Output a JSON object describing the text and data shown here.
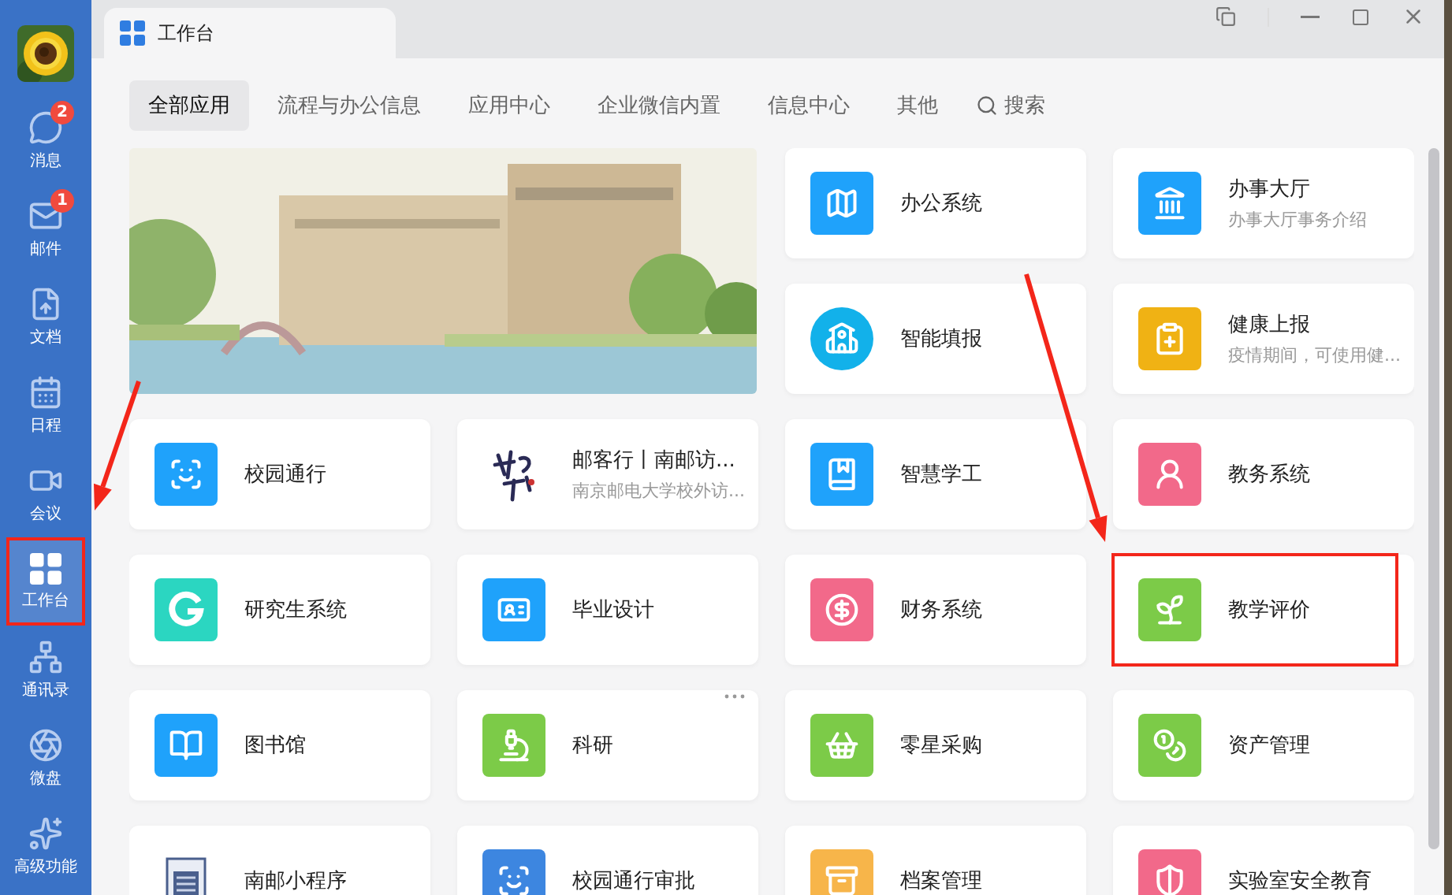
{
  "sidebar": {
    "items": [
      {
        "label": "消息",
        "badge": "2",
        "selected": false,
        "highlighted": false
      },
      {
        "label": "邮件",
        "badge": "1",
        "selected": false,
        "highlighted": false
      },
      {
        "label": "文档",
        "selected": false,
        "highlighted": false
      },
      {
        "label": "日程",
        "selected": false,
        "highlighted": false
      },
      {
        "label": "会议",
        "selected": false,
        "highlighted": false
      },
      {
        "label": "工作台",
        "selected": true,
        "highlighted": true
      },
      {
        "label": "通讯录",
        "selected": false,
        "highlighted": false
      },
      {
        "label": "微盘",
        "selected": false,
        "highlighted": false
      },
      {
        "label": "高级功能",
        "selected": false,
        "highlighted": false
      }
    ]
  },
  "window": {
    "tab_title": "工作台"
  },
  "filter_tabs": [
    {
      "label": "全部应用",
      "selected": true
    },
    {
      "label": "流程与办公信息",
      "selected": false
    },
    {
      "label": "应用中心",
      "selected": false
    },
    {
      "label": "企业微信内置",
      "selected": false
    },
    {
      "label": "信息中心",
      "selected": false
    },
    {
      "label": "其他",
      "selected": false
    }
  ],
  "search": {
    "label": "搜索"
  },
  "apps": [
    {
      "name": "办公系统",
      "kind": "tile",
      "color": "#1fa2fb",
      "highlighted": false
    },
    {
      "name": "办事大厅",
      "subtitle": "办事大厅事务介绍",
      "kind": "tile",
      "color": "#1fa2fb",
      "highlighted": false
    },
    {
      "name": "智能填报",
      "kind": "round",
      "color": "#12b1ea",
      "highlighted": false
    },
    {
      "name": "健康上报",
      "subtitle": "疫情期间，可使用健...",
      "kind": "tile",
      "color": "#f0b214",
      "highlighted": false
    },
    {
      "name": "校园通行",
      "kind": "tile",
      "color": "#1fa2fb",
      "highlighted": false
    },
    {
      "name": "邮客行丨南邮访...",
      "subtitle": "南京邮电大学校外访...",
      "kind": "logo",
      "highlighted": false
    },
    {
      "name": "智慧学工",
      "kind": "tile",
      "color": "#1fa2fb",
      "highlighted": false
    },
    {
      "name": "教务系统",
      "kind": "tile",
      "color": "#f2698a",
      "highlighted": false
    },
    {
      "name": "研究生系统",
      "kind": "tile",
      "color": "#2bd6c1",
      "highlighted": false
    },
    {
      "name": "毕业设计",
      "kind": "tile",
      "color": "#1fa2fb",
      "highlighted": false
    },
    {
      "name": "财务系统",
      "kind": "tile",
      "color": "#f2698a",
      "highlighted": false
    },
    {
      "name": "教学评价",
      "kind": "tile",
      "color": "#7ccb48",
      "highlighted": true
    },
    {
      "name": "图书馆",
      "kind": "tile",
      "color": "#1fa2fb",
      "highlighted": false
    },
    {
      "name": "科研",
      "kind": "tile",
      "color": "#7ccb48",
      "highlighted": false,
      "more": true
    },
    {
      "name": "零星采购",
      "kind": "tile",
      "color": "#7ccb48",
      "highlighted": false
    },
    {
      "name": "资产管理",
      "kind": "tile",
      "color": "#7ccb48",
      "highlighted": false
    },
    {
      "name": "南邮小程序",
      "kind": "emblem",
      "highlighted": false
    },
    {
      "name": "校园通行审批",
      "kind": "tile",
      "color": "#3d86e0",
      "highlighted": false
    },
    {
      "name": "档案管理",
      "kind": "tile",
      "color": "#f7b54a",
      "highlighted": false
    },
    {
      "name": "实验室安全教育",
      "kind": "tile",
      "color": "#f2698a",
      "highlighted": false
    }
  ]
}
